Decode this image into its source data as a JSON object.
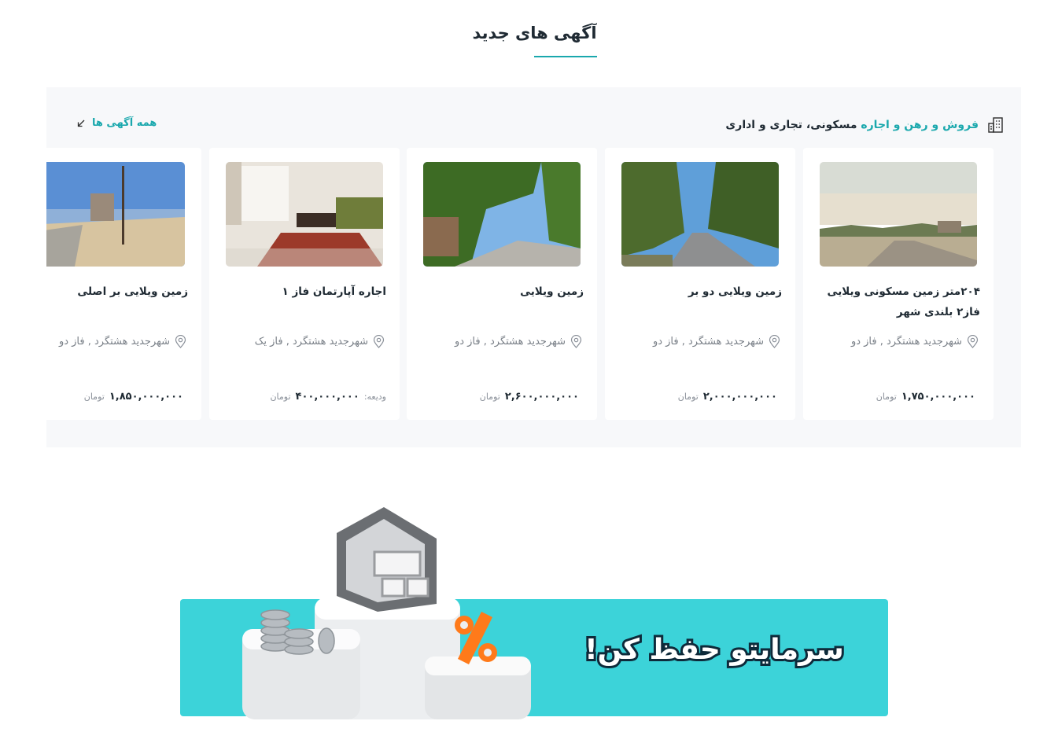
{
  "section": {
    "title": "آگهی های جدید"
  },
  "panel": {
    "header_accent": "فروش و رهن و اجاره",
    "header_rest": " مسکونی، تجاری و اداری",
    "all_ads_label": "همه آگهی ها"
  },
  "cards": [
    {
      "title": "۲۰۴متر زمین مسکونی ویلایی فاز۲ بلندی شهر",
      "location": "شهرجدید هشتگرد , فاز دو",
      "price_prefix": "",
      "price": "۱,۷۵۰,۰۰۰,۰۰۰",
      "unit": "تومان",
      "image": "landscape-road-hills"
    },
    {
      "title": "زمین ویلایی دو بر",
      "location": "شهرجدید هشتگرد , فاز دو",
      "price_prefix": "",
      "price": "۲,۰۰۰,۰۰۰,۰۰۰",
      "unit": "تومان",
      "image": "tree-lined-street"
    },
    {
      "title": "زمین ویلایی",
      "location": "شهرجدید هشتگرد , فاز دو",
      "price_prefix": "",
      "price": "۲,۶۰۰,۰۰۰,۰۰۰",
      "unit": "تومان",
      "image": "green-trees-alley"
    },
    {
      "title": "اجاره آپارتمان فاز ۱",
      "location": "شهرجدید هشتگرد , فاز یک",
      "price_prefix": "ودیعه:",
      "price": "۴۰۰,۰۰۰,۰۰۰",
      "unit": "تومان",
      "image": "living-room-interior"
    },
    {
      "title": "زمین ویلایی بر اصلی",
      "location": "شهرجدید هشتگرد , فاز دو",
      "price_prefix": "",
      "price": "۱,۸۵۰,۰۰۰,۰۰۰",
      "unit": "تومان",
      "image": "dirt-road-poles"
    }
  ],
  "banner": {
    "slogan": "سرمایتو حفظ کن!",
    "background_color": "#3cd3d9",
    "accent_color": "#1aa8ad"
  }
}
